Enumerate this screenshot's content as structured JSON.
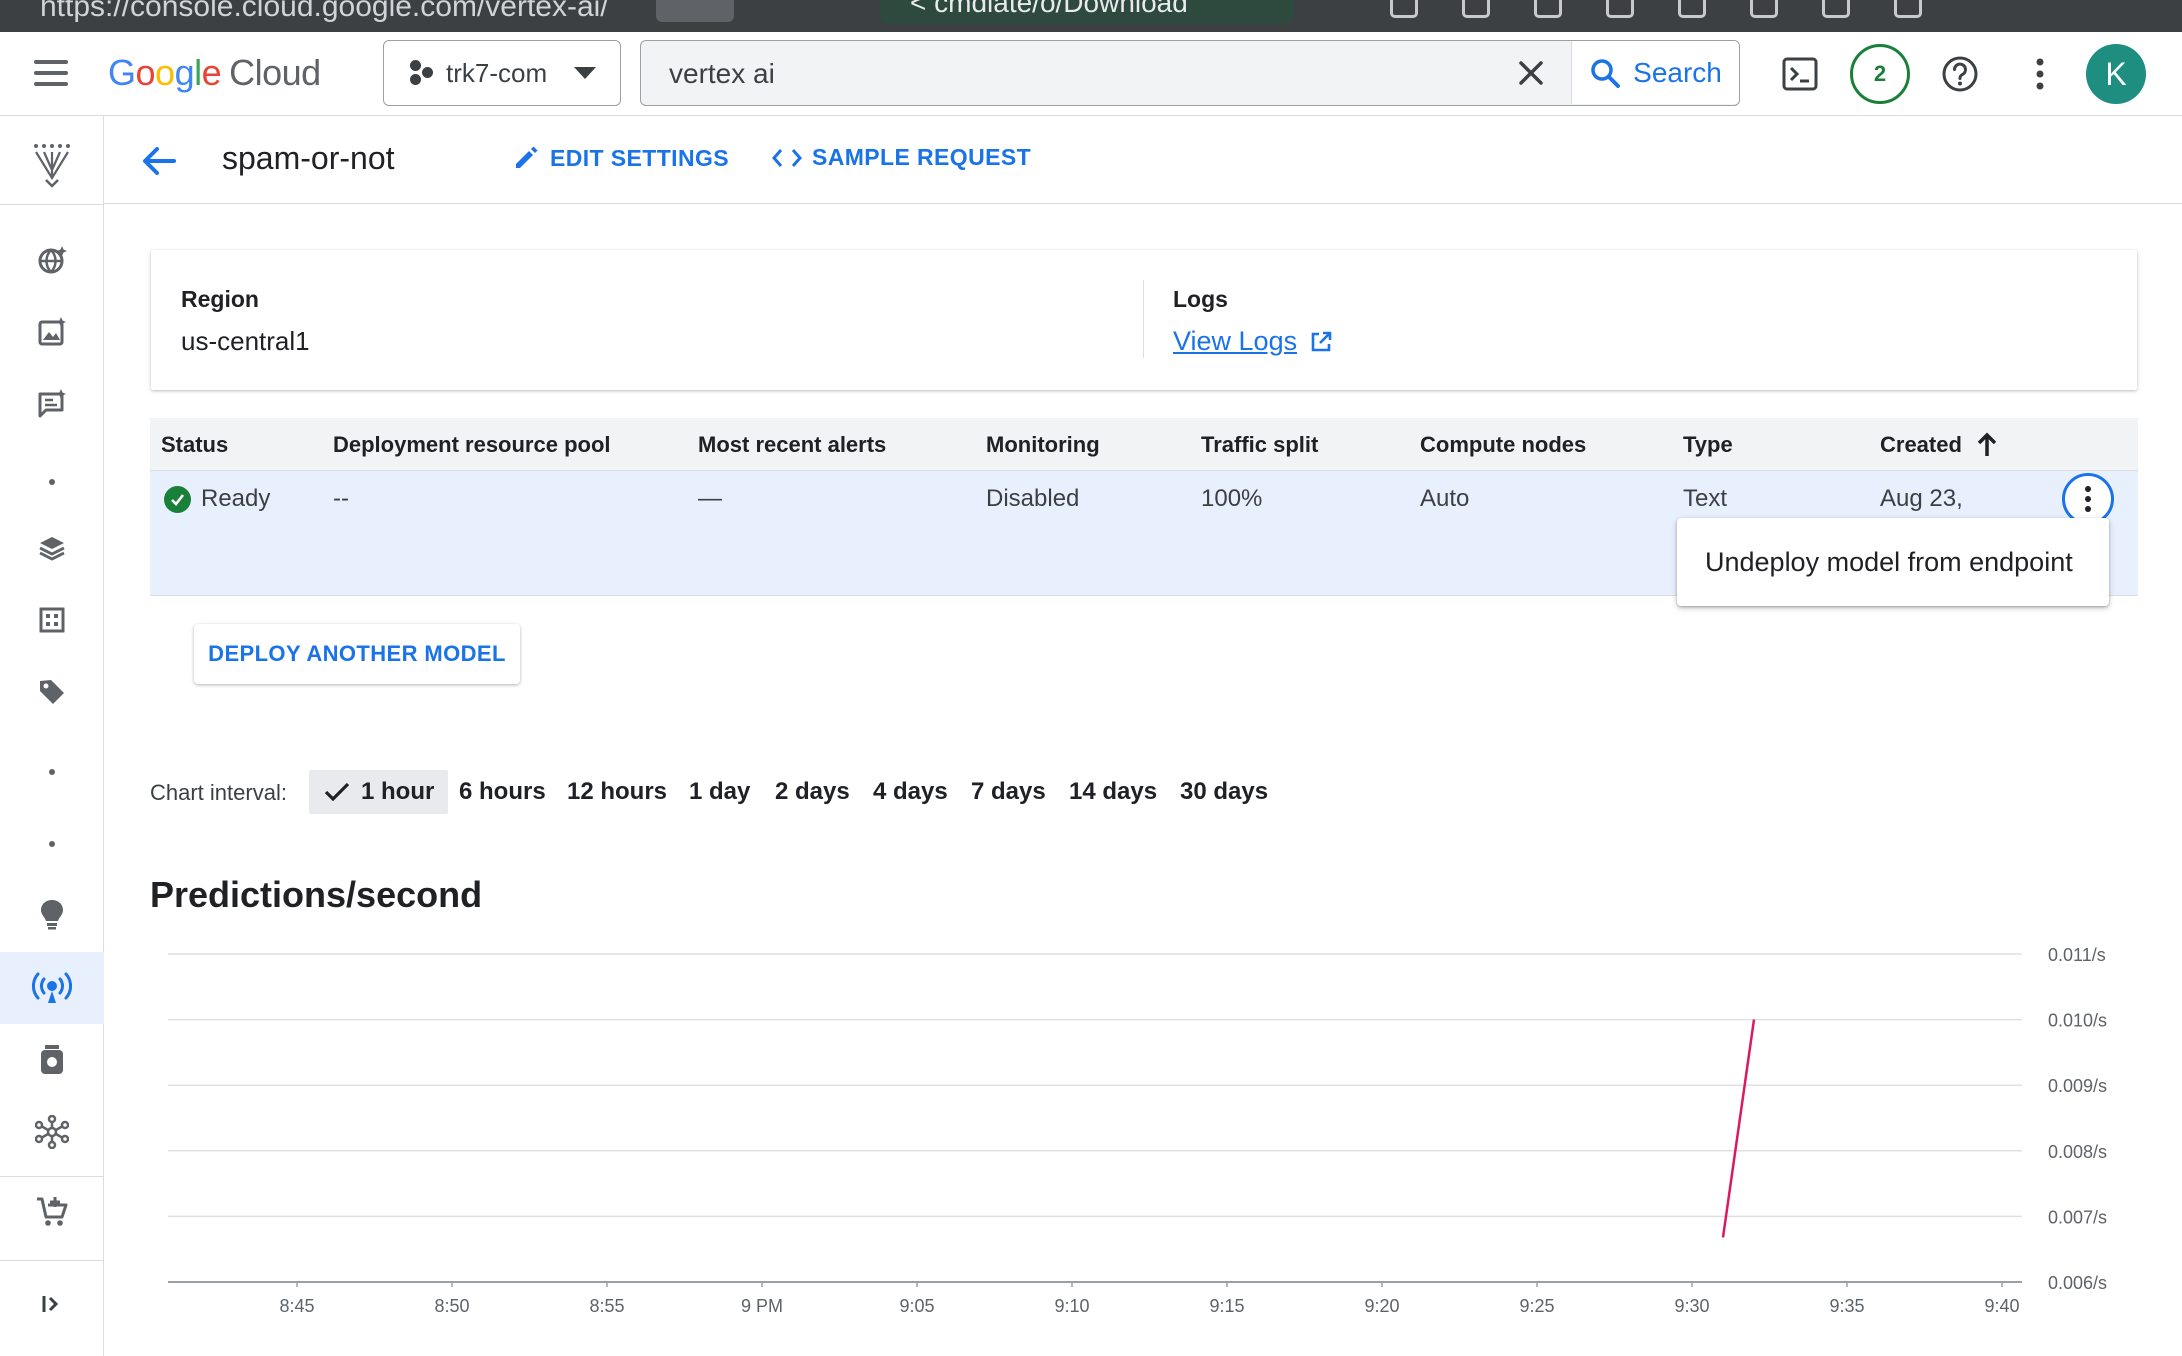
{
  "browser": {
    "url_fragment": "https://console.cloud.google.com/vertex-ai/",
    "tab_label": "< cmdlate/o/Download"
  },
  "topbar": {
    "logo_google": [
      "G",
      "o",
      "o",
      "g",
      "l",
      "e"
    ],
    "logo_cloud": "Cloud",
    "project": "trk7-com",
    "search_value": "vertex ai",
    "search_label": "Search",
    "notifications": "2",
    "avatar_initial": "K"
  },
  "header": {
    "title": "spam-or-not",
    "edit_settings": "EDIT SETTINGS",
    "sample_request": "SAMPLE REQUEST"
  },
  "info": {
    "region_label": "Region",
    "region_value": "us-central1",
    "logs_label": "Logs",
    "logs_link": "View Logs"
  },
  "table": {
    "headers": [
      "Status",
      "Deployment resource pool",
      "Most recent alerts",
      "Monitoring",
      "Traffic split",
      "Compute nodes",
      "Type",
      "Created"
    ],
    "row": {
      "status": "Ready",
      "pool": "--",
      "alerts": "—",
      "monitoring": "Disabled",
      "traffic": "100%",
      "nodes": "Auto",
      "type": "Text",
      "created": "Aug 23,"
    }
  },
  "row_menu": {
    "item": "Undeploy model from endpoint"
  },
  "deploy_button": "DEPLOY ANOTHER MODEL",
  "interval": {
    "label": "Chart interval:",
    "options": [
      "1 hour",
      "6 hours",
      "12 hours",
      "1 day",
      "2 days",
      "4 days",
      "7 days",
      "14 days",
      "30 days"
    ],
    "selected": "1 hour"
  },
  "chart_data": {
    "type": "line",
    "title": "Predictions/second",
    "xlabel": "",
    "ylabel": "",
    "x_ticks": [
      "8:45",
      "8:50",
      "8:55",
      "9 PM",
      "9:05",
      "9:10",
      "9:15",
      "9:20",
      "9:25",
      "9:30",
      "9:35",
      "9:40"
    ],
    "y_ticks": [
      "0.011/s",
      "0.010/s",
      "0.009/s",
      "0.008/s",
      "0.007/s",
      "0.006/s"
    ],
    "ylim": [
      0.006,
      0.011
    ],
    "grid": true,
    "series": [
      {
        "color": "#d81b60",
        "x": [
          "9:31",
          "9:32"
        ],
        "y": [
          0.00668,
          0.01
        ]
      }
    ]
  },
  "colors": {
    "accent": "#1a73e8",
    "ready": "#188038",
    "series": "#d81b60"
  }
}
